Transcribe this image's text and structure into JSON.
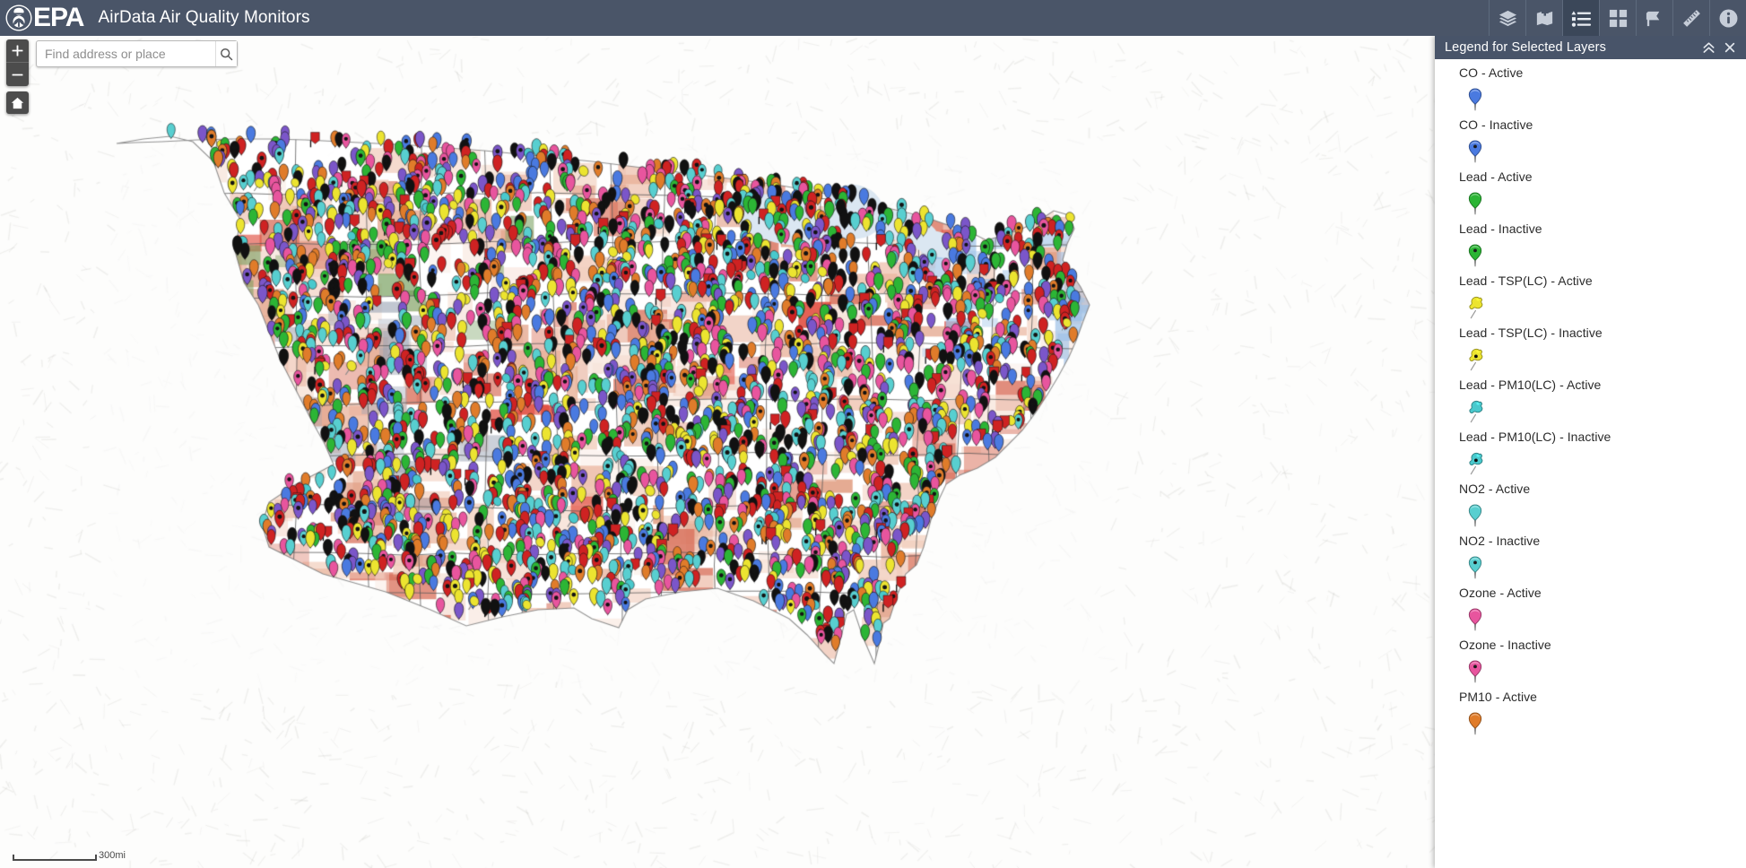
{
  "header": {
    "logo_text": "EPA",
    "logo_icon": "epa-seal-icon",
    "title": "AirData Air Quality Monitors",
    "background_color": "#4a5568",
    "tools": [
      {
        "name": "layer-list-icon",
        "label": "Layer List",
        "active": false
      },
      {
        "name": "add-data-icon",
        "label": "Add Data",
        "active": false
      },
      {
        "name": "legend-icon",
        "label": "Legend",
        "active": true
      },
      {
        "name": "basemap-gallery-icon",
        "label": "Basemap Gallery",
        "active": false
      },
      {
        "name": "bookmark-icon",
        "label": "Bookmark",
        "active": false
      },
      {
        "name": "measure-icon",
        "label": "Measure",
        "active": false
      },
      {
        "name": "about-info-icon",
        "label": "About",
        "active": false
      }
    ]
  },
  "map_controls": {
    "zoom_in_label": "+",
    "zoom_out_label": "−",
    "home_label": "Default extent",
    "scalebar_label": "300mi"
  },
  "search": {
    "placeholder": "Find address or place",
    "value": "",
    "submit_icon": "search-icon"
  },
  "legend": {
    "title": "Legend for Selected Layers",
    "collapse_icon": "chevron-double-up-icon",
    "close_icon": "close-icon",
    "header_color": "#485469",
    "entries": [
      {
        "label": "CO - Active",
        "symbol": "pin",
        "color": "#4a7ae0",
        "state": "active"
      },
      {
        "label": "CO - Inactive",
        "symbol": "pin",
        "color": "#4a7ae0",
        "state": "inactive"
      },
      {
        "label": "Lead - Active",
        "symbol": "pin",
        "color": "#2cb535",
        "state": "active"
      },
      {
        "label": "Lead - Inactive",
        "symbol": "pin",
        "color": "#2cb535",
        "state": "inactive"
      },
      {
        "label": "Lead - TSP(LC) - Active",
        "symbol": "pushpin",
        "color": "#ece430",
        "state": "active"
      },
      {
        "label": "Lead - TSP(LC) - Inactive",
        "symbol": "pushpin",
        "color": "#ece430",
        "state": "inactive"
      },
      {
        "label": "Lead - PM10(LC) - Active",
        "symbol": "pushpin",
        "color": "#49c9cd",
        "state": "active"
      },
      {
        "label": "Lead - PM10(LC) - Inactive",
        "symbol": "pushpin",
        "color": "#49c9cd",
        "state": "inactive"
      },
      {
        "label": "NO2 - Active",
        "symbol": "pin",
        "color": "#58cfd0",
        "state": "active"
      },
      {
        "label": "NO2 - Inactive",
        "symbol": "pin",
        "color": "#58cfd0",
        "state": "inactive"
      },
      {
        "label": "Ozone - Active",
        "symbol": "pin",
        "color": "#e8559e",
        "state": "active"
      },
      {
        "label": "Ozone - Inactive",
        "symbol": "pin",
        "color": "#e8559e",
        "state": "inactive"
      },
      {
        "label": "PM10 - Active",
        "symbol": "pin",
        "color": "#e07c2a",
        "state": "active"
      }
    ]
  },
  "map": {
    "basemap": "light-gray-terrain",
    "marker_palette": [
      "#e8559e",
      "#4a7ae0",
      "#e07c2a",
      "#58cfd0",
      "#2cb535",
      "#ece430",
      "#7b56c9",
      "#111111",
      "#cf2222"
    ],
    "county_shades": [
      "#f7e3d8",
      "#f2cfbe",
      "#eab39c",
      "#e09a7e",
      "#d9715c"
    ]
  }
}
